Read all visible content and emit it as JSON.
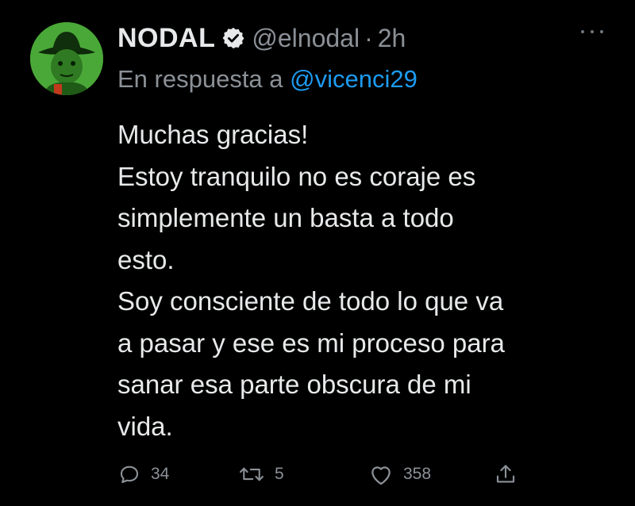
{
  "tweet": {
    "display_name": "NODAL",
    "verified_icon": "verified-badge-icon",
    "handle": "@elnodal",
    "separator": "·",
    "time": "2h",
    "reply_prefix": "En respuesta a ",
    "reply_to": "@vicenci29",
    "body_lines": [
      "Muchas gracias!",
      "Estoy tranquilo no es coraje es",
      "simplemente un basta a todo",
      "esto.",
      "Soy consciente de todo lo que va",
      "a pasar y ese es mi proceso para",
      "sanar esa parte obscura de mi",
      "vida."
    ],
    "actions": {
      "replies": "34",
      "retweets": "5",
      "likes": "358"
    }
  },
  "colors": {
    "background": "#000000",
    "text": "#e7e9ea",
    "muted": "#8b9197",
    "accent": "#1d9bf0"
  },
  "icons": {
    "reply": "reply-bubble-icon",
    "retweet": "retweet-icon",
    "like": "heart-icon",
    "share": "share-upload-icon",
    "more": "more-dots-icon"
  }
}
